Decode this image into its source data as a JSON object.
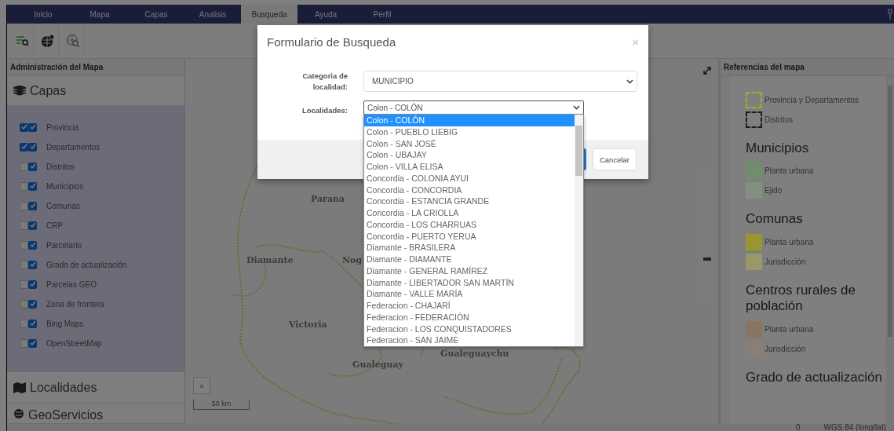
{
  "nav": {
    "items": [
      {
        "label": "Inicio",
        "selected": false
      },
      {
        "label": "Mapa",
        "selected": false
      },
      {
        "label": "Capas",
        "selected": false
      },
      {
        "label": "Analisis",
        "selected": false
      },
      {
        "label": "Busqueda",
        "selected": true
      },
      {
        "label": "Ayuda",
        "selected": false
      },
      {
        "label": "Perfil",
        "selected": false
      }
    ]
  },
  "left_panel": {
    "title": "Administración del Mapa",
    "capas": {
      "title": "Capas",
      "layers": [
        {
          "label": "Provincia",
          "checked": true,
          "active": true
        },
        {
          "label": "Departamentos",
          "checked": true,
          "active": true
        },
        {
          "label": "Distritos",
          "checked": false,
          "active": true
        },
        {
          "label": "Municipios",
          "checked": false,
          "active": true
        },
        {
          "label": "Comunas",
          "checked": false,
          "active": true
        },
        {
          "label": "CRP",
          "checked": false,
          "active": true
        },
        {
          "label": "Parcelario",
          "checked": false,
          "active": true
        },
        {
          "label": "Grado de actualización",
          "checked": false,
          "active": true
        },
        {
          "label": "Parcelas GEO",
          "checked": false,
          "active": true
        },
        {
          "label": "Zona de frontera",
          "checked": false,
          "active": true
        },
        {
          "label": "Bing Maps",
          "checked": false,
          "active": true
        },
        {
          "label": "OpenStreetMap",
          "checked": false,
          "active": true
        }
      ]
    },
    "sections": [
      "Localidades",
      "GeoServicios"
    ]
  },
  "map": {
    "zoom": {
      "level": 0.33
    },
    "labels": [
      "Parana",
      "Diamante",
      "Nog",
      "Victoria",
      "Gualeguay",
      "Gualeguaychu"
    ],
    "expand_button": "»",
    "scale": "50 km"
  },
  "right_panel": {
    "title": "Referencias del mapa",
    "outlines": [
      {
        "label": "Provincia y Departamentos",
        "color": "#a8a830"
      },
      {
        "label": "Distritos",
        "color": "#1a1a1a"
      }
    ],
    "groups": [
      {
        "title": "Municipios",
        "items": [
          {
            "label": "Planta urbana",
            "color": "#6f8f6a"
          },
          {
            "label": "Ejido",
            "color": "#838f80"
          }
        ]
      },
      {
        "title": "Comunas",
        "items": [
          {
            "label": "Planta urbana",
            "color": "#9a9530"
          },
          {
            "label": "Jurisdicción",
            "color": "#9a9868"
          }
        ]
      },
      {
        "title": "Centros rurales de población",
        "items": [
          {
            "label": "Planta urbana",
            "color": "#8a7560"
          },
          {
            "label": "Jurisdicción",
            "color": "#8a7e75"
          }
        ]
      },
      {
        "title": "Grado de actualización"
      }
    ]
  },
  "status_bar": {
    "value": "0",
    "projection": "WGS 84 (long/lat)"
  },
  "dialog": {
    "title": "Formulario de Busqueda",
    "close": "×",
    "category_label": "Categoria de localidad:",
    "category_value": "MUNICIPIO",
    "localities_label": "Localidades:",
    "localities_value": "Colon - COLÓN",
    "options": [
      {
        "label": "Colon - COLÓN",
        "selected": true
      },
      {
        "label": "Colon - PUEBLO LIEBIG",
        "selected": false
      },
      {
        "label": "Colon - SAN JOSÉ",
        "selected": false
      },
      {
        "label": "Colon - UBAJAY",
        "selected": false
      },
      {
        "label": "Colon - VILLA ELISA",
        "selected": false
      },
      {
        "label": "Concordia - COLONIA AYUI",
        "selected": false
      },
      {
        "label": "Concordia - CONCORDIA",
        "selected": false
      },
      {
        "label": "Concordia - ESTANCIA GRANDE",
        "selected": false
      },
      {
        "label": "Concordia - LA CRIOLLA",
        "selected": false
      },
      {
        "label": "Concordia - LOS CHARRUAS",
        "selected": false
      },
      {
        "label": "Concordia - PUERTO YERUA",
        "selected": false
      },
      {
        "label": "Diamante - BRASILERA",
        "selected": false
      },
      {
        "label": "Diamante - DIAMANTE",
        "selected": false
      },
      {
        "label": "Diamante - GENERAL RAMÍREZ",
        "selected": false
      },
      {
        "label": "Diamante - LIBERTADOR SAN MARTÍN",
        "selected": false
      },
      {
        "label": "Diamante - VALLE MARÍA",
        "selected": false
      },
      {
        "label": "Federacion - CHAJARÍ",
        "selected": false
      },
      {
        "label": "Federacion - FEDERACIÓN",
        "selected": false
      },
      {
        "label": "Federacion - LOS CONQUISTADORES",
        "selected": false
      },
      {
        "label": "Federacion - SAN JAIME",
        "selected": false
      }
    ],
    "cancel": "Cancelar"
  }
}
